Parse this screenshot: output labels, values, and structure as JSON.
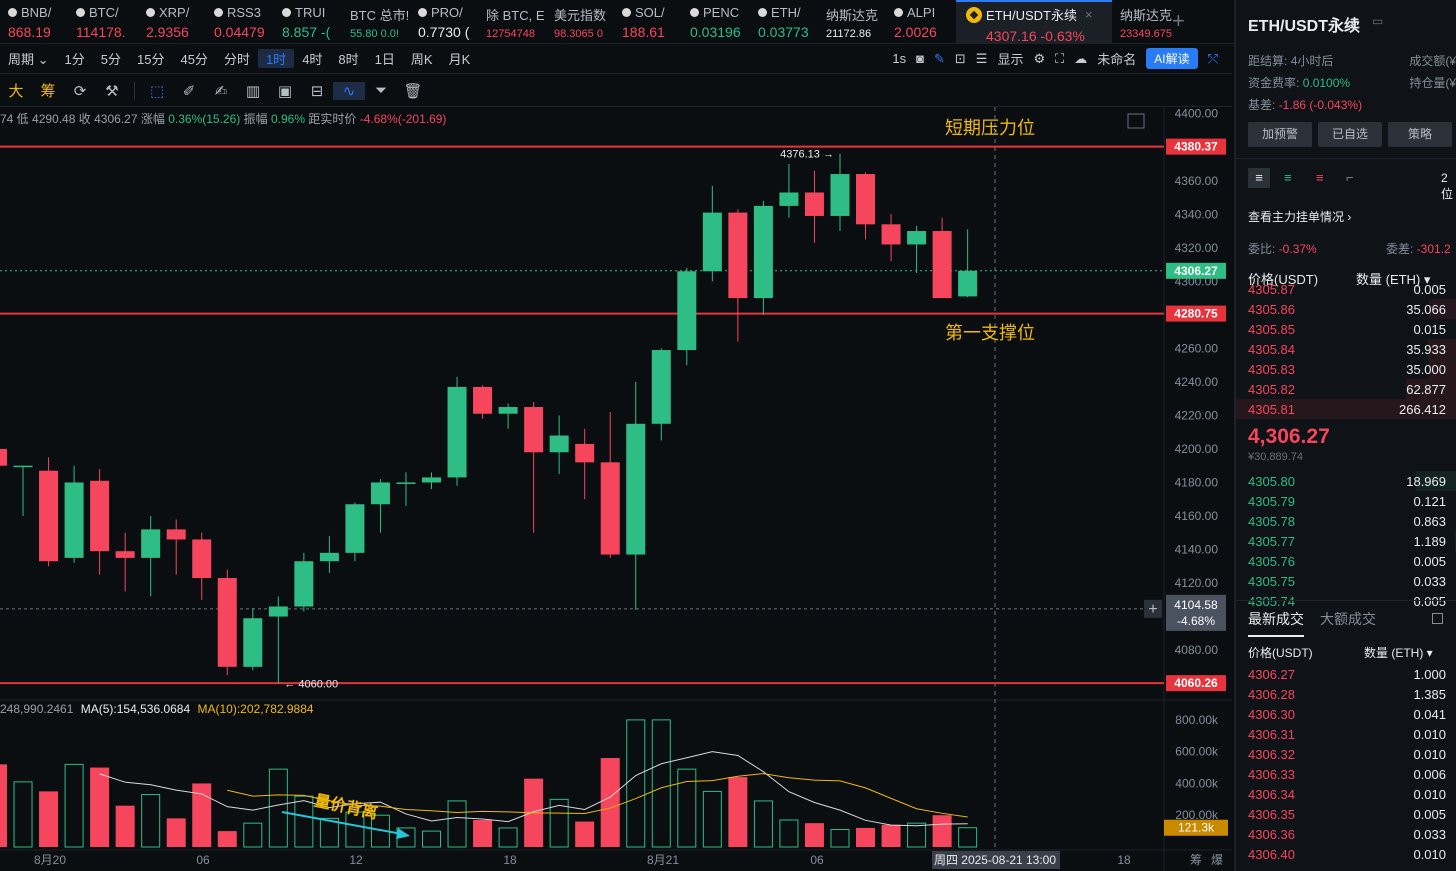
{
  "ticker": [
    {
      "name": "BNB/",
      "price": "868.19",
      "dir": "down"
    },
    {
      "name": "BTC/",
      "price": "114178.",
      "dir": "down"
    },
    {
      "name": "XRP/",
      "price": "2.9356",
      "dir": "down"
    },
    {
      "name": "RSS3",
      "price": "0.04479",
      "dir": "down"
    },
    {
      "name": "TRUI",
      "price": "8.857 -(",
      "dir": "up"
    },
    {
      "name": "BTC 总市!",
      "price": "55.80  0.0!",
      "dir": "up",
      "small": true
    },
    {
      "name": "PRO/",
      "price": "0.7730 (",
      "dir": "neutral"
    },
    {
      "name": "除 BTC, E",
      "price": "12754748",
      "dir": "down",
      "small": true
    },
    {
      "name": "美元指数",
      "price": "98.3065  0",
      "dir": "down",
      "small": true
    },
    {
      "name": "SOL/",
      "price": "188.61",
      "dir": "down"
    },
    {
      "name": "PENC",
      "price": "0.03196",
      "dir": "up"
    },
    {
      "name": "ETH/",
      "price": "0.03773",
      "dir": "up"
    },
    {
      "name": "纳斯达克",
      "price": "21172.86",
      "dir": "neutral",
      "small": true
    },
    {
      "name": "ALPI",
      "price": "2.0026",
      "dir": "down"
    }
  ],
  "active_tab": {
    "name": "ETH/USDT永续",
    "price": "4307.16  -0.63%"
  },
  "extra_tab": {
    "name": "纳斯达克",
    "price": "23349.675"
  },
  "toolbar": {
    "period_label": "周期",
    "intervals": [
      "1分",
      "5分",
      "15分",
      "45分",
      "分时",
      "1时",
      "4时",
      "8时",
      "1日",
      "周K",
      "月K"
    ],
    "selected": "1时",
    "right_1s": "1s",
    "display": "显示",
    "unnamed": "未命名",
    "ai": "AI解读"
  },
  "tools": [
    "大",
    "筹"
  ],
  "info_line": {
    "low_label": "74  低",
    "low": "4290.48",
    "close_label": "收",
    "close": "4306.27",
    "change_label": "涨幅",
    "change": "0.36%(15.26)",
    "amp_label": "振幅",
    "amp": "0.96%",
    "dist_label": "距实时价",
    "dist": "-4.68%(-201.69)"
  },
  "vol_info": {
    "vol": "248,990.2461",
    "ma5": "MA(5):154,536.0684",
    "ma10": "MA(10):202,782.9884"
  },
  "annotations": {
    "resistance": "短期压力位",
    "support": "第一支撑位",
    "divergence": "量价背离"
  },
  "levels": {
    "top": "4380.37",
    "support": "4280.75",
    "bottom": "4060.26",
    "last": "4306.27",
    "cross_price": "4104.58",
    "cross_pct": "-4.68%",
    "high_mark": "4376.13",
    "low_mark": "4060.00",
    "vol_last": "121.3k"
  },
  "price_axis": [
    "4400.00",
    "4380.00",
    "4360.00",
    "4340.00",
    "4320.00",
    "4300.00",
    "4280.00",
    "4260.00",
    "4240.00",
    "4220.00",
    "4200.00",
    "4180.00",
    "4160.00",
    "4140.00",
    "4120.00",
    "4100.00",
    "4080.00",
    "4060.00"
  ],
  "vol_axis": [
    "800.00k",
    "600.00k",
    "400.00k",
    "200.00k"
  ],
  "time_axis": [
    "8月20",
    "06",
    "12",
    "18",
    "8月21",
    "06",
    "周四 2025-08-21 13:00",
    "18"
  ],
  "corner_labels": [
    "筹",
    "爆"
  ],
  "chart_data": {
    "type": "candlestick",
    "interval": "1h",
    "candles": [
      [
        4200.0,
        4262.0,
        4160.0,
        4190.0
      ],
      [
        4190.0,
        4190.0,
        4160.0,
        4190.0
      ],
      [
        4187.0,
        4195.0,
        4130.0,
        4133.0
      ],
      [
        4135.0,
        4190.0,
        4132.0,
        4180.0
      ],
      [
        4181.0,
        4188.0,
        4125.0,
        4139.0
      ],
      [
        4139.0,
        4150.0,
        4115.0,
        4135.0
      ],
      [
        4135.0,
        4160.0,
        4112.0,
        4152.0
      ],
      [
        4152.0,
        4158.0,
        4125.0,
        4146.0
      ],
      [
        4146.0,
        4150.0,
        4110.0,
        4123.0
      ],
      [
        4123.0,
        4128.0,
        4065.0,
        4070.0
      ],
      [
        4070.0,
        4105.0,
        4068.0,
        4099.0
      ],
      [
        4100.0,
        4112.0,
        4060.0,
        4106.0
      ],
      [
        4106.0,
        4138.0,
        4103.0,
        4133.0
      ],
      [
        4133.0,
        4148.0,
        4126.0,
        4138.0
      ],
      [
        4138.0,
        4168.0,
        4133.0,
        4167.0
      ],
      [
        4167.0,
        4182.0,
        4150.0,
        4180.0
      ],
      [
        4180.0,
        4186.0,
        4166.0,
        4180.0
      ],
      [
        4180.0,
        4186.0,
        4176.0,
        4183.0
      ],
      [
        4183.0,
        4243.0,
        4178.0,
        4237.0
      ],
      [
        4237.0,
        4238.0,
        4218.0,
        4221.0
      ],
      [
        4221.0,
        4227.0,
        4212.0,
        4225.0
      ],
      [
        4225.0,
        4228.0,
        4150.0,
        4198.0
      ],
      [
        4198.0,
        4220.0,
        4185.0,
        4208.0
      ],
      [
        4203.0,
        4212.0,
        4170.0,
        4192.0
      ],
      [
        4192.0,
        4222.0,
        4135.0,
        4137.0
      ],
      [
        4137.0,
        4240.0,
        4104.0,
        4215.0
      ],
      [
        4215.0,
        4260.0,
        4205.0,
        4259.0
      ],
      [
        4259.0,
        4308.0,
        4250.0,
        4306.0
      ],
      [
        4306.0,
        4357.0,
        4300.0,
        4341.0
      ],
      [
        4341.0,
        4343.0,
        4264.0,
        4290.0
      ],
      [
        4290.0,
        4348.0,
        4280.0,
        4345.0
      ],
      [
        4345.0,
        4370.0,
        4338.0,
        4353.0
      ],
      [
        4353.0,
        4366.0,
        4323.0,
        4339.0
      ],
      [
        4339.0,
        4376.13,
        4330.0,
        4364.0
      ],
      [
        4364.0,
        4365.0,
        4325.0,
        4334.0
      ],
      [
        4334.0,
        4340.0,
        4312.0,
        4322.0
      ],
      [
        4322.0,
        4333.0,
        4305.0,
        4330.0
      ],
      [
        4330.0,
        4338.0,
        4290.0,
        4290.0
      ],
      [
        4291.0,
        4331.0,
        4290.48,
        4306.27
      ]
    ],
    "volumes": [
      520,
      410,
      350,
      520,
      500,
      260,
      330,
      180,
      400,
      100,
      150,
      490,
      320,
      180,
      220,
      200,
      120,
      100,
      290,
      170,
      120,
      430,
      300,
      160,
      560,
      800,
      800,
      490,
      350,
      440,
      290,
      170,
      150,
      110,
      120,
      140,
      150,
      200,
      121.3
    ],
    "ma5_volume": 154536.0684,
    "ma10_volume": 202782.9884,
    "ylim": [
      4052.0,
      4404.0
    ],
    "vol_max": 900
  },
  "right_panel": {
    "title": "ETH/USDT永续",
    "settle_label": "距结算:",
    "settle": "4小时后",
    "funding_label": "资金费率:",
    "funding": "0.0100%",
    "basis_label": "基差:",
    "basis": "-1.86 (-0.043%)",
    "vol_label": "成交额(¥)",
    "oi_label": "持仓量(¥)",
    "buttons": [
      "加预警",
      "已自选",
      "策略"
    ],
    "decimals": "2位",
    "depth_link": "查看主力挂单情况",
    "ratio_label": "委比:",
    "ratio": "-0.37%",
    "diff_label": "委差:",
    "diff": "-301.2",
    "price_hdr": "价格(USDT)",
    "qty_hdr": "数量 (ETH)",
    "asks": [
      [
        "4305.87",
        "0.005"
      ],
      [
        "4305.86",
        "35.066"
      ],
      [
        "4305.85",
        "0.015"
      ],
      [
        "4305.84",
        "35.933"
      ],
      [
        "4305.83",
        "35.000"
      ],
      [
        "4305.82",
        "62.877"
      ],
      [
        "4305.81",
        "266.412"
      ]
    ],
    "last_price": "4,306.27",
    "last_cny": "¥30,889.74",
    "bids": [
      [
        "4305.80",
        "18.969"
      ],
      [
        "4305.79",
        "0.121"
      ],
      [
        "4305.78",
        "0.863"
      ],
      [
        "4305.77",
        "1.189"
      ],
      [
        "4305.76",
        "0.005"
      ],
      [
        "4305.75",
        "0.033"
      ],
      [
        "4305.74",
        "0.005"
      ]
    ],
    "trades_tab": "最新成交",
    "big_tab": "大额成交",
    "trades": [
      [
        "4306.27",
        "1.000"
      ],
      [
        "4306.28",
        "1.385"
      ],
      [
        "4306.30",
        "0.041"
      ],
      [
        "4306.31",
        "0.010"
      ],
      [
        "4306.32",
        "0.010"
      ],
      [
        "4306.33",
        "0.006"
      ],
      [
        "4306.34",
        "0.010"
      ],
      [
        "4306.35",
        "0.005"
      ],
      [
        "4306.36",
        "0.033"
      ],
      [
        "4306.40",
        "0.010"
      ]
    ]
  },
  "colors": {
    "up": "#2ebd85",
    "down": "#f6465d",
    "accent": "#2a7cf6",
    "annotation": "#f0b90b",
    "level_line": "#e8333c"
  }
}
